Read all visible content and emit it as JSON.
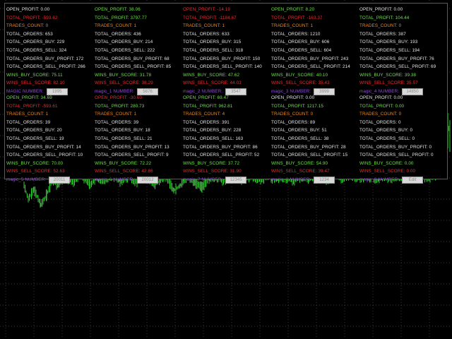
{
  "colors": {
    "background": "#000000",
    "grid": "#3a3a3a",
    "candles": "#2bd12b",
    "positive": "#6ee24a",
    "negative": "#e53030",
    "trades_count": "#ee8a1c",
    "neutral": "#e6e6e6",
    "magic_label": "#8e4fd6"
  },
  "panel": {
    "cells": [
      {
        "open_profit": "OPEN_PROFIT: 0.00",
        "open_profit_color": "white",
        "total_profit": "TOTAL_PROFIT: -593.62",
        "total_profit_color": "red",
        "trades_count": "TRADES_COUNT: 0",
        "total_orders": "TOTAL_ORDERS: 653",
        "total_orders_buy": "TOTAL_ORDERS_BUY: 229",
        "total_orders_sell": "TOTAL_ORDERS_SELL: 324",
        "total_orders_buy_profit": "TOTAL_ORDERS_BUY_PROFIT: 172",
        "total_orders_sell_profit": "TOTAL_ORDERS_SELL_PROFIT: 266",
        "wins_buy_score": "WINS_BUY_SCORE: 75.11",
        "wins_sell_score": "WINS_SELL_SCORE: 82.10",
        "magic_label": "MAGIC NUMBER:",
        "magic_value": "1995"
      },
      {
        "open_profit": "OPEN_PROFIT: 38.06",
        "open_profit_color": "green",
        "total_profit": "TOTAL_PROFIT: 3797.77",
        "total_profit_color": "green",
        "trades_count": "TRADES_COUNT: 1",
        "total_orders": "TOTAL_ORDERS: 436",
        "total_orders_buy": "TOTAL_ORDERS_BUY: 214",
        "total_orders_sell": "TOTAL_ORDERS_SELL: 222",
        "total_orders_buy_profit": "TOTAL_ORDERS_BUY_PROFIT: 68",
        "total_orders_sell_profit": "TOTAL_ORDERS_SELL_PROFIT: 85",
        "wins_buy_score": "WINS_BUY_SCORE: 31.78",
        "wins_sell_score": "WINS_SELL_SCORE: 38.29",
        "magic_label": "magic_1 NUMBER:",
        "magic_value": "5876"
      },
      {
        "open_profit": "OPEN_PROFIT: -14.19",
        "open_profit_color": "red",
        "total_profit": "TOTAL_PROFIT: -1184.67",
        "total_profit_color": "red",
        "trades_count": "TRADES_COUNT: 1",
        "total_orders": "TOTAL_ORDERS: 633",
        "total_orders_buy": "TOTAL_ORDERS_BUY: 315",
        "total_orders_sell": "TOTAL_ORDERS_SELL: 318",
        "total_orders_buy_profit": "TOTAL_ORDERS_BUY_PROFIT: 150",
        "total_orders_sell_profit": "TOTAL_ORDERS_SELL_PROFIT: 140",
        "wins_buy_score": "WINS_BUY_SCORE: 47.62",
        "wins_sell_score": "WINS_SELL_SCORE: 44.03",
        "magic_label": "magic_2 NUMBER:",
        "magic_value": "3547"
      },
      {
        "open_profit": "OPEN_PROFIT: 8.20",
        "open_profit_color": "green",
        "total_profit": "TOTAL_PROFIT: -163.37",
        "total_profit_color": "red",
        "trades_count": "TRADES_COUNT: 1",
        "total_orders": "TOTAL_ORDERS: 1210",
        "total_orders_buy": "TOTAL_ORDERS_BUY: 606",
        "total_orders_sell": "TOTAL_ORDERS_SELL: 604",
        "total_orders_buy_profit": "TOTAL_ORDERS_BUY_PROFIT: 243",
        "total_orders_sell_profit": "TOTAL_ORDERS_SELL_PROFIT: 214",
        "wins_buy_score": "WINS_BUY_SCORE: 40.10",
        "wins_sell_score": "WINS_SELL_SCORE: 35.43",
        "magic_label": "magic_3 NUMBER:",
        "magic_value": "3999"
      },
      {
        "open_profit": "OPEN_PROFIT: 0.00",
        "open_profit_color": "white",
        "total_profit": "TOTAL_PROFIT: 104.44",
        "total_profit_color": "green",
        "trades_count": "TRADES_COUNT: 0",
        "total_orders": "TOTAL_ORDERS: 387",
        "total_orders_buy": "TOTAL_ORDERS_BUY: 193",
        "total_orders_sell": "TOTAL_ORDERS_SELL: 194",
        "total_orders_buy_profit": "TOTAL_ORDERS_BUY_PROFIT: 76",
        "total_orders_sell_profit": "TOTAL_ORDERS_SELL_PROFIT: 69",
        "wins_buy_score": "WINS_BUY_SCORE: 39.38",
        "wins_sell_score": "WINS_SELL_SCORE: 35.57",
        "magic_label": "magic_4 NUMBER:",
        "magic_value": "14850"
      },
      {
        "open_profit": "OPEN_PROFIT: 34.69",
        "open_profit_color": "green",
        "total_profit": "TOTAL_PROFIT: -593.61",
        "total_profit_color": "red",
        "trades_count": "TRADES_COUNT: 1",
        "total_orders": "TOTAL_ORDERS: 39",
        "total_orders_buy": "TOTAL_ORDERS_BUY: 20",
        "total_orders_sell": "TOTAL_ORDERS_SELL: 19",
        "total_orders_buy_profit": "TOTAL_ORDERS_BUY_PROFIT: 14",
        "total_orders_sell_profit": "TOTAL_ORDERS_SELL_PROFIT: 10",
        "wins_buy_score": "WINS_BUY_SCORE: 70.00",
        "wins_sell_score": "WINS_SELL_SCORE: 52.63",
        "magic_label": "magic_5 NUMBER:",
        "magic_value": "20011"
      },
      {
        "open_profit": "OPEN_PROFIT: -30.60",
        "open_profit_color": "red",
        "total_profit": "TOTAL_PROFIT: 280.73",
        "total_profit_color": "green",
        "trades_count": "TRADES_COUNT: 1",
        "total_orders": "TOTAL_ORDERS: 39",
        "total_orders_buy": "TOTAL_ORDERS_BUY: 18",
        "total_orders_sell": "TOTAL_ORDERS_SELL: 21",
        "total_orders_buy_profit": "TOTAL_ORDERS_BUY_PROFIT: 13",
        "total_orders_sell_profit": "TOTAL_ORDERS_SELL_PROFIT: 9",
        "wins_buy_score": "WINS_BUY_SCORE: 72.22",
        "wins_sell_score": "WINS_SELL_SCORE: 42.86",
        "magic_label": "magic_6 NUMBER:",
        "magic_value": "20012"
      },
      {
        "open_profit": "OPEN_PROFIT: 69.47",
        "open_profit_color": "green",
        "total_profit": "TOTAL_PROFIT: 962.81",
        "total_profit_color": "green",
        "trades_count": "TRADES_COUNT: 4",
        "total_orders": "TOTAL_ORDERS: 391",
        "total_orders_buy": "TOTAL_ORDERS_BUY: 228",
        "total_orders_sell": "TOTAL_ORDERS_SELL: 163",
        "total_orders_buy_profit": "TOTAL_ORDERS_BUY_PROFIT: 86",
        "total_orders_sell_profit": "TOTAL_ORDERS_SELL_PROFIT: 52",
        "wins_buy_score": "WINS_BUY_SCORE: 37.72",
        "wins_sell_score": "WINS_SELL_SCORE: 31.90",
        "magic_label": "magic_7 NUMBER:",
        "magic_value": "12345"
      },
      {
        "open_profit": "OPEN_PROFIT: 0.00",
        "open_profit_color": "white",
        "total_profit": "TOTAL_PROFIT: 1217.15",
        "total_profit_color": "green",
        "trades_count": "TRADES_COUNT: 0",
        "total_orders": "TOTAL_ORDERS: 89",
        "total_orders_buy": "TOTAL_ORDERS_BUY: 51",
        "total_orders_sell": "TOTAL_ORDERS_SELL: 38",
        "total_orders_buy_profit": "TOTAL_ORDERS_BUY_PROFIT: 28",
        "total_orders_sell_profit": "TOTAL_ORDERS_SELL_PROFIT: 15",
        "wins_buy_score": "WINS_BUY_SCORE: 54.90",
        "wins_sell_score": "WINS_SELL_SCORE: 39.47",
        "magic_label": "magic_8 NUMBER:",
        "magic_value": "1234"
      },
      {
        "open_profit": "OPEN_PROFIT: 0.00",
        "open_profit_color": "white",
        "total_profit": "TOTAL_PROFIT: 0.00",
        "total_profit_color": "green",
        "trades_count": "TRADES_COUNT: 0",
        "total_orders": "TOTAL_ORDERS: 0",
        "total_orders_buy": "TOTAL_ORDERS_BUY: 0",
        "total_orders_sell": "TOTAL_ORDERS_SELL: 0",
        "total_orders_buy_profit": "TOTAL_ORDERS_BUY_PROFIT: 0",
        "total_orders_sell_profit": "TOTAL_ORDERS_SELL_PROFIT: 0",
        "wins_buy_score": "WINS_BUY_SCORE: 0.00",
        "wins_sell_score": "WINS_SELL_SCORE: 0.00",
        "magic_label": "magic_9 NUMBER:",
        "magic_value": "Edit"
      }
    ]
  }
}
